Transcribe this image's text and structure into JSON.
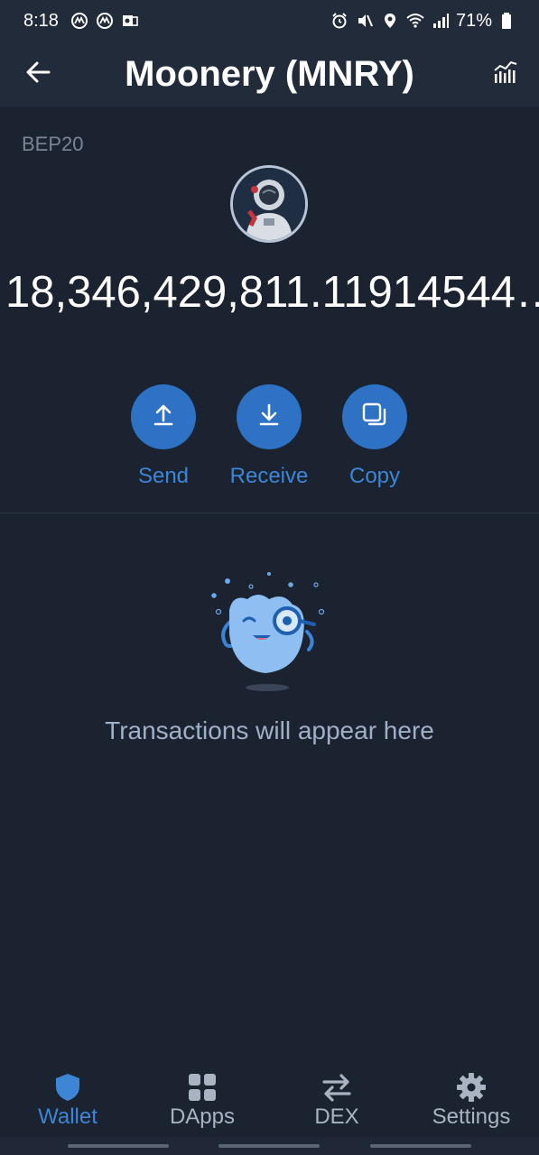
{
  "status_bar": {
    "time": "8:18",
    "battery": "71%"
  },
  "header": {
    "title": "Moonery (MNRY)",
    "back_icon": "arrow-left-icon",
    "chart_icon": "chart-icon"
  },
  "token": {
    "network": "BEP20",
    "balance": "18,346,429,811.11914544…",
    "avatar_icon": "astronaut-avatar"
  },
  "actions": [
    {
      "label": "Send",
      "icon": "upload-icon"
    },
    {
      "label": "Receive",
      "icon": "download-icon"
    },
    {
      "label": "Copy",
      "icon": "copy-icon"
    }
  ],
  "empty_state": {
    "message": "Transactions will appear here"
  },
  "nav": {
    "items": [
      {
        "label": "Wallet",
        "icon": "shield-icon",
        "active": true
      },
      {
        "label": "DApps",
        "icon": "grid-icon",
        "active": false
      },
      {
        "label": "DEX",
        "icon": "swap-icon",
        "active": false
      },
      {
        "label": "Settings",
        "icon": "gear-icon",
        "active": false
      }
    ]
  },
  "colors": {
    "background": "#1b2230",
    "header": "#222b3a",
    "accent": "#2d72c4",
    "accent_text": "#3d86d6"
  }
}
